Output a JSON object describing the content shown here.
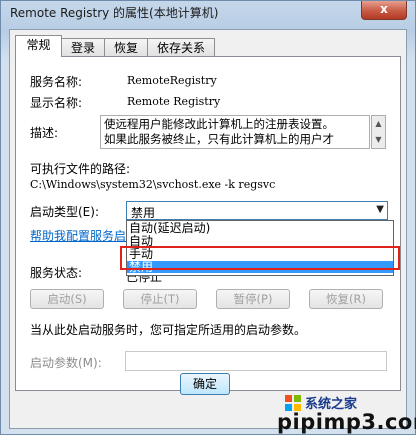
{
  "window": {
    "title": "Remote Registry 的属性(本地计算机)",
    "close_label": "x"
  },
  "tabs": [
    "常规",
    "登录",
    "恢复",
    "依存关系"
  ],
  "general": {
    "service_name_label": "服务名称:",
    "service_name": "RemoteRegistry",
    "display_name_label": "显示名称:",
    "display_name": "Remote Registry",
    "description_label": "描述:",
    "description_line1": "使远程用户能修改此计算机上的注册表设置。",
    "description_line2": "如果此服务被终止，只有此计算机上的用户才",
    "path_label": "可执行文件的路径:",
    "path": "C:\\Windows\\system32\\svchost.exe -k regsvc",
    "startup_type_label": "启动类型(E):",
    "startup_type_value": "禁用",
    "startup_options": [
      "自动(延迟启动)",
      "自动",
      "手动",
      "禁用"
    ],
    "selected_option": "禁用",
    "help_link": "帮助我配置服务启",
    "status_label": "服务状态:",
    "status_value": "已停止",
    "buttons": {
      "start": "启动(S)",
      "stop": "停止(T)",
      "pause": "暂停(P)",
      "resume": "恢复(R)"
    },
    "hint": "当从此处启动服务时，您可指定所适用的启动参数。",
    "param_label": "启动参数(M):"
  },
  "footer": {
    "ok_label": "确定"
  },
  "watermark": {
    "text1": "系统之家",
    "text2": "pipimp3.com"
  }
}
